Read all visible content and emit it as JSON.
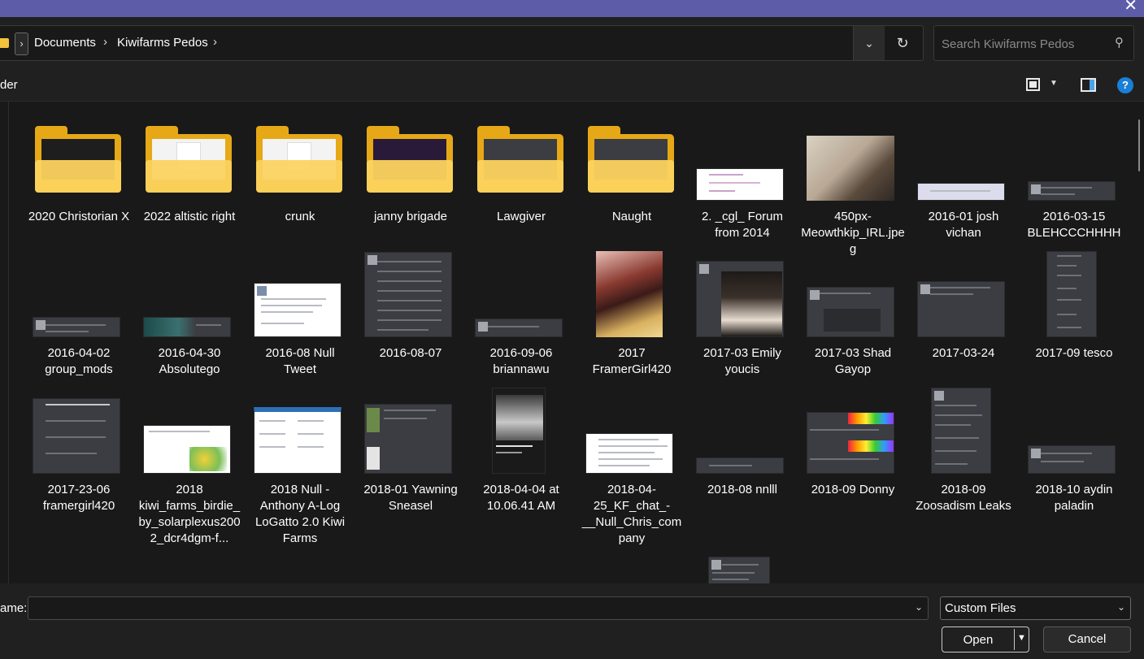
{
  "titlebar": {
    "close_glyph": "✕"
  },
  "address": {
    "breadcrumb": [
      "Documents",
      "Kiwifarms Pedos"
    ],
    "separator": "›",
    "search_placeholder": "Search Kiwifarms Pedos"
  },
  "command": {
    "partial_label": "der"
  },
  "items": [
    {
      "label": "2020  Christorian X",
      "kind": "folder-dark"
    },
    {
      "label": "2022 altistic right",
      "kind": "folder"
    },
    {
      "label": "crunk",
      "kind": "folder"
    },
    {
      "label": "janny brigade",
      "kind": "folder-dark"
    },
    {
      "label": "Lawgiver",
      "kind": "folder-dark"
    },
    {
      "label": "Naught",
      "kind": "folder-dark"
    },
    {
      "label": "2. _cgl_ Forum from 2014",
      "kind": "shot"
    },
    {
      "label": "450px-Meowthkip_IRL.jpeg",
      "kind": "photo"
    },
    {
      "label": "2016-01 josh vichan",
      "kind": "shot"
    },
    {
      "label": "2016-03-15 BLEHCCCHHHH",
      "kind": "shot"
    },
    {
      "label": "2016-04-02 group_mods",
      "kind": "shot"
    },
    {
      "label": "2016-04-30 Absolutego",
      "kind": "shot"
    },
    {
      "label": "2016-08 Null Tweet",
      "kind": "shot"
    },
    {
      "label": "2016-08-07",
      "kind": "shot"
    },
    {
      "label": "2016-09-06 briannawu",
      "kind": "shot"
    },
    {
      "label": "2017 FramerGirl420",
      "kind": "photo"
    },
    {
      "label": "2017-03 Emily youcis",
      "kind": "photo"
    },
    {
      "label": "2017-03 Shad Gayop",
      "kind": "shot"
    },
    {
      "label": "2017-03-24",
      "kind": "shot"
    },
    {
      "label": "2017-09 tesco",
      "kind": "shot"
    },
    {
      "label": "2017-23-06 framergirl420",
      "kind": "shot"
    },
    {
      "label": "2018 kiwi_farms_birdie_by_solarplexus2002_dcr4dgm-f...",
      "kind": "shot"
    },
    {
      "label": "2018 Null - Anthony A-Log LoGatto 2.0 Kiwi Farms",
      "kind": "shot"
    },
    {
      "label": "2018-01 Yawning Sneasel",
      "kind": "shot"
    },
    {
      "label": "2018-04-04 at 10.06.41 AM",
      "kind": "shot"
    },
    {
      "label": "2018-04-25_KF_chat_-__Null_Chris_company",
      "kind": "shot"
    },
    {
      "label": "2018-08 nnlll",
      "kind": "shot"
    },
    {
      "label": "2018-09 Donny",
      "kind": "shot"
    },
    {
      "label": "2018-09 Zoosadism Leaks",
      "kind": "shot"
    },
    {
      "label": "2018-10 aydin paladin",
      "kind": "shot"
    },
    {
      "label": "",
      "kind": "shot"
    }
  ],
  "bottom": {
    "filename_label": "ame:",
    "filename_value": "",
    "filetype": "Custom Files",
    "open_label": "Open",
    "cancel_label": "Cancel"
  },
  "colors": {
    "titlebar": "#5c5ca8",
    "folder": "#fcd35e",
    "accent": "#1a7fd6"
  }
}
